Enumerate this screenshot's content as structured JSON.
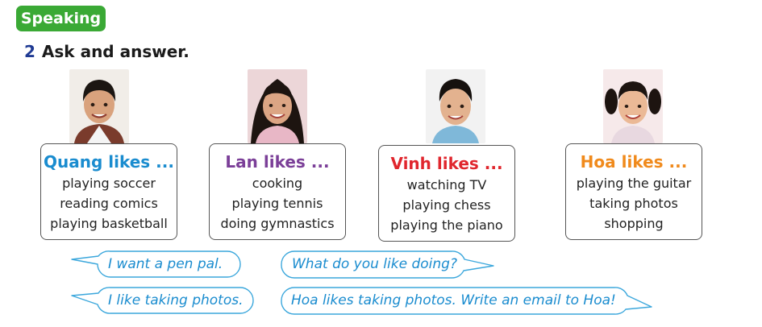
{
  "section_label": "Speaking",
  "exercise": {
    "number": "2",
    "title": "Ask and answer."
  },
  "people": [
    {
      "name_line": "Quang likes ...",
      "color": "#1a8ccf",
      "activities": [
        "playing soccer",
        "reading comics",
        "playing basketball"
      ]
    },
    {
      "name_line": "Lan likes ...",
      "color": "#7b3f98",
      "activities": [
        "cooking",
        "playing tennis",
        "doing gymnastics"
      ]
    },
    {
      "name_line": "Vinh likes ...",
      "color": "#e0262d",
      "activities": [
        "watching TV",
        "playing chess",
        "playing the piano"
      ]
    },
    {
      "name_line": "Hoa likes ...",
      "color": "#f08a1c",
      "activities": [
        "playing the guitar",
        "taking photos",
        "shopping"
      ]
    }
  ],
  "speech_bubbles": [
    {
      "text": "I want a pen pal."
    },
    {
      "text": "What do you like doing?"
    },
    {
      "text": "I like taking photos."
    },
    {
      "text": "Hoa likes taking photos. Write an email to Hoa!"
    }
  ],
  "colors": {
    "badge_bg": "#3aa935",
    "number": "#1f3a93",
    "bubble_text": "#1a8ccf",
    "bubble_border": "#3ba7dc"
  }
}
